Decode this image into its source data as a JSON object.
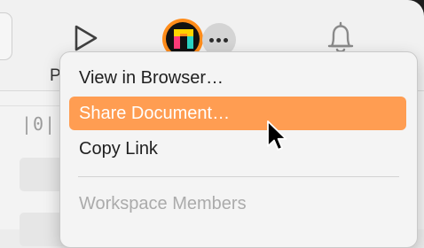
{
  "toolbar": {
    "play_label": "P"
  },
  "content": {
    "column_icon_text": "|0|"
  },
  "menu": {
    "items": [
      {
        "label": "View in Browser…",
        "state": "normal"
      },
      {
        "label": "Share Document…",
        "state": "highlighted"
      },
      {
        "label": "Copy Link",
        "state": "normal"
      },
      {
        "label": "Workspace Members",
        "state": "disabled"
      }
    ]
  },
  "colors": {
    "highlight": "#ff9d52",
    "avatar_ring": "#ff8c1a"
  },
  "icons": [
    "play-icon",
    "avatar",
    "more-icon",
    "bell-icon",
    "pointer-cursor-icon"
  ]
}
